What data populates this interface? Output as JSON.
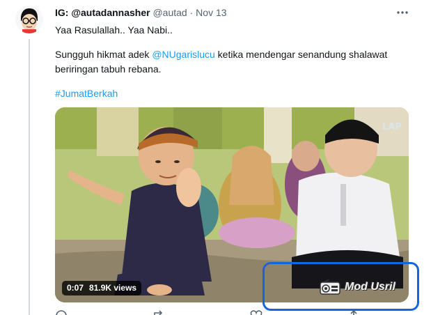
{
  "tweet": {
    "display_name": "IG: @autadannasher",
    "handle": "@autad",
    "separator": "·",
    "date": "Nov 13",
    "line1": "Yaa Rasulallah.. Yaa Nabi..",
    "line2_before": "Sungguh hikmat adek ",
    "line2_mention": "@NUgarislucu",
    "line2_after": " ketika mendengar senandung shalawat",
    "line3": "beriringan tabuh rebana.",
    "hashtag": "#JumatBerkah"
  },
  "video": {
    "duration": "0:07",
    "views": "81.9K views",
    "watermark": "Mod Usril"
  },
  "icons": {
    "more": "more-horizontal-icon",
    "reply": "reply-icon",
    "retweet": "retweet-icon",
    "like": "heart-icon",
    "share": "share-icon"
  },
  "colors": {
    "link": "#1d9bf0",
    "secondary_text": "#536471",
    "highlight": "#1565e0"
  }
}
